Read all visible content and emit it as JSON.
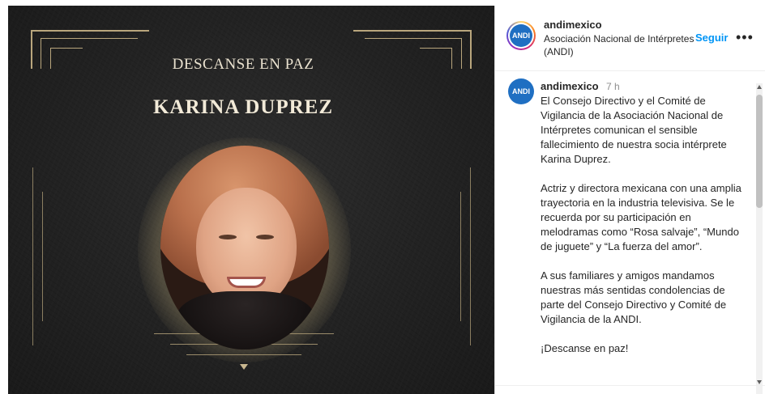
{
  "post_image": {
    "heading_small": "DESCANSE EN PAZ",
    "heading_name": "KARINA DUPREZ",
    "accent_color": "#b9a67d"
  },
  "header": {
    "username": "andimexico",
    "subtitle": "Asociación Nacional de Intérpretes (ANDI)",
    "follow_label": "Seguir",
    "more_label": "•••"
  },
  "comment": {
    "username": "andimexico",
    "time": "7 h",
    "paragraphs": [
      "El Consejo Directivo y el Comité de Vigilancia de la Asociación Nacional de Intérpretes comunican el sensible fallecimiento de nuestra socia intérprete Karina Duprez.",
      "Actriz y directora mexicana con una amplia trayectoria en la industria televisiva. Se le recuerda por su participación en melodramas como “Rosa salvaje”, “Mundo de juguete” y “La fuerza del amor”.",
      "A sus familiares y amigos mandamos nuestras más sentidas condolencias de parte del Consejo Directivo y Comité de Vigilancia de la ANDI.",
      "¡Descanse en paz!"
    ]
  },
  "colors": {
    "link_blue": "#0095f6",
    "text": "#262626",
    "muted": "#8e8e8e"
  }
}
